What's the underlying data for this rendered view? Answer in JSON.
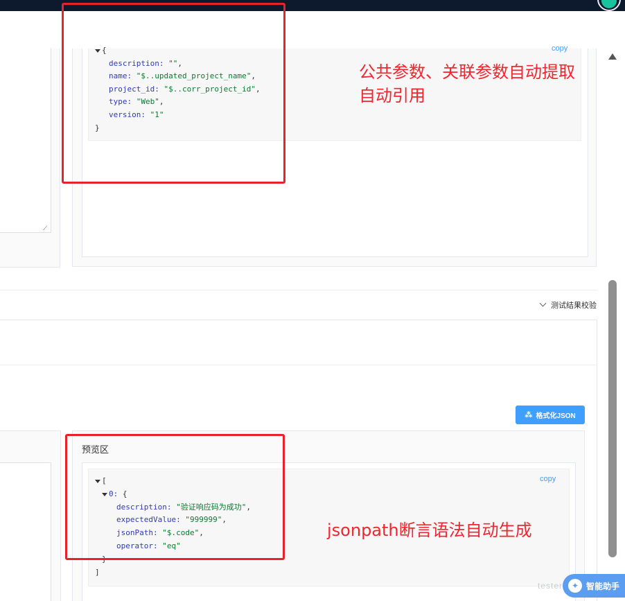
{
  "colors": {
    "topbar": "#0d1a2e",
    "accent": "#409eff",
    "annotation": "#e8222b",
    "json_key": "#2f3ab8",
    "json_string": "#0a7a2f"
  },
  "top_code": {
    "copy_label": "copy",
    "lines": {
      "open": "{",
      "description_key": "description:",
      "description_val": "\"\"",
      "name_key": "name:",
      "name_val": "\"$..updated_project_name\"",
      "project_id_key": "project_id:",
      "project_id_val": "\"$..corr_project_id\"",
      "type_key": "type:",
      "type_val": "\"Web\"",
      "version_key": "version:",
      "version_val": "\"1\"",
      "close": "}"
    }
  },
  "annotations": {
    "top_line1": "公共参数、关联参数自动提取",
    "top_line2": "自动引用",
    "bottom": "jsonpath断言语法自动生成"
  },
  "collapse": {
    "label": "测试结果校验"
  },
  "format_button": {
    "icon": "sparkle-icon",
    "label": "格式化JSON"
  },
  "preview": {
    "title": "预览区",
    "copy_label": "copy",
    "lines": {
      "open_bracket": "[",
      "index_key": "0:",
      "open_brace": "{",
      "description_key": "description:",
      "description_val": "\"验证响应码为成功\"",
      "expected_key": "expectedValue:",
      "expected_val": "\"999999\"",
      "jsonpath_key": "jsonPath:",
      "jsonpath_val": "\"$.code\"",
      "operator_key": "operator:",
      "operator_val": "\"eq\"",
      "close_brace": "}",
      "close_bracket": "]"
    }
  },
  "assistant": {
    "label": "智能助手",
    "watermark": "testerhome.com"
  }
}
